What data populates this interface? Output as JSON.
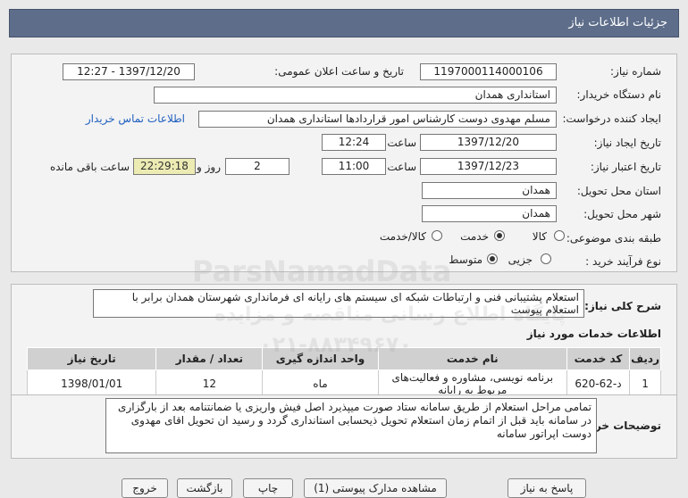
{
  "header": {
    "title": "جزئیات اطلاعات نیاز"
  },
  "form": {
    "need_number": {
      "label": "شماره نیاز:",
      "value": "1197000114000106"
    },
    "announce": {
      "label": "تاریخ و ساعت اعلان عمومی:",
      "value": "1397/12/20 - 12:27"
    },
    "buyer_org": {
      "label": "نام دستگاه خریدار:",
      "value": "استانداری همدان"
    },
    "requester": {
      "label": "ایجاد کننده درخواست:",
      "value": "مسلم مهدوی دوست کارشناس امور قراردادها استانداری همدان",
      "contact_link": "اطلاعات تماس خریدار"
    },
    "created": {
      "label": "تاریخ ایجاد نیاز:",
      "date": "1397/12/20",
      "time_label": "ساعت",
      "time": "12:24"
    },
    "validity": {
      "label": "تاریخ اعتبار نیاز:",
      "date": "1397/12/23",
      "time_label": "ساعت",
      "time": "11:00",
      "days": "2",
      "days_label": "روز و",
      "remaining": "22:29:18",
      "remaining_label": "ساعت باقی مانده"
    },
    "province": {
      "label": "استان محل تحویل:",
      "value": "همدان"
    },
    "city": {
      "label": "شهر محل تحویل:",
      "value": "همدان"
    },
    "category": {
      "label": "طبقه بندی موضوعی:",
      "options": [
        "کالا",
        "خدمت",
        "کالا/خدمت"
      ],
      "selected": "خدمت"
    },
    "process": {
      "label": "نوع فرآیند خرید :",
      "options": [
        "جزیی",
        "متوسط"
      ],
      "selected": "متوسط"
    }
  },
  "description": {
    "label": "شرح کلی نیاز:",
    "value": "استعلام پشتیبانی فنی و ارتباطات شبکه ای  سیستم های رایانه ای فرمانداری شهرستان همدان برابر با استعلام پیوست"
  },
  "services": {
    "title": "اطلاعات خدمات مورد نیاز",
    "columns": [
      "ردیف",
      "کد خدمت",
      "نام خدمت",
      "واحد اندازه گیری",
      "تعداد / مقدار",
      "تاریخ نیاز"
    ],
    "rows": [
      [
        "1",
        "د-62-620",
        "برنامه نویسی، مشاوره و فعالیت‌های مربوط به رایانه",
        "ماه",
        "12",
        "1398/01/01"
      ]
    ]
  },
  "buyer_notes": {
    "label": "توضیحات خریدار:",
    "value": "تمامی مراحل استعلام از طریق سامانه ستاد صورت میپذیرد اصل فیش واریزی یا ضمانتنامه بعد از بارگزاری در سامانه باید قبل از اتمام زمان استعلام تحویل ذیحسابی استانداری گردد و رسید ان تحویل اقای مهدوی دوست اپراتور سامانه"
  },
  "bottom_buttons": [
    "پاسخ به نیاز",
    "مشاهده مدارک پیوستی (1)",
    "چاپ",
    "بازگشت",
    "خروج"
  ],
  "watermark": {
    "brand": "ParsNamadData",
    "fa": "پایگاه اطلاع رسانی مناقصه و مزایده",
    "phone": "۰۲۱-۸۸۳۴۹۶۷۰"
  }
}
